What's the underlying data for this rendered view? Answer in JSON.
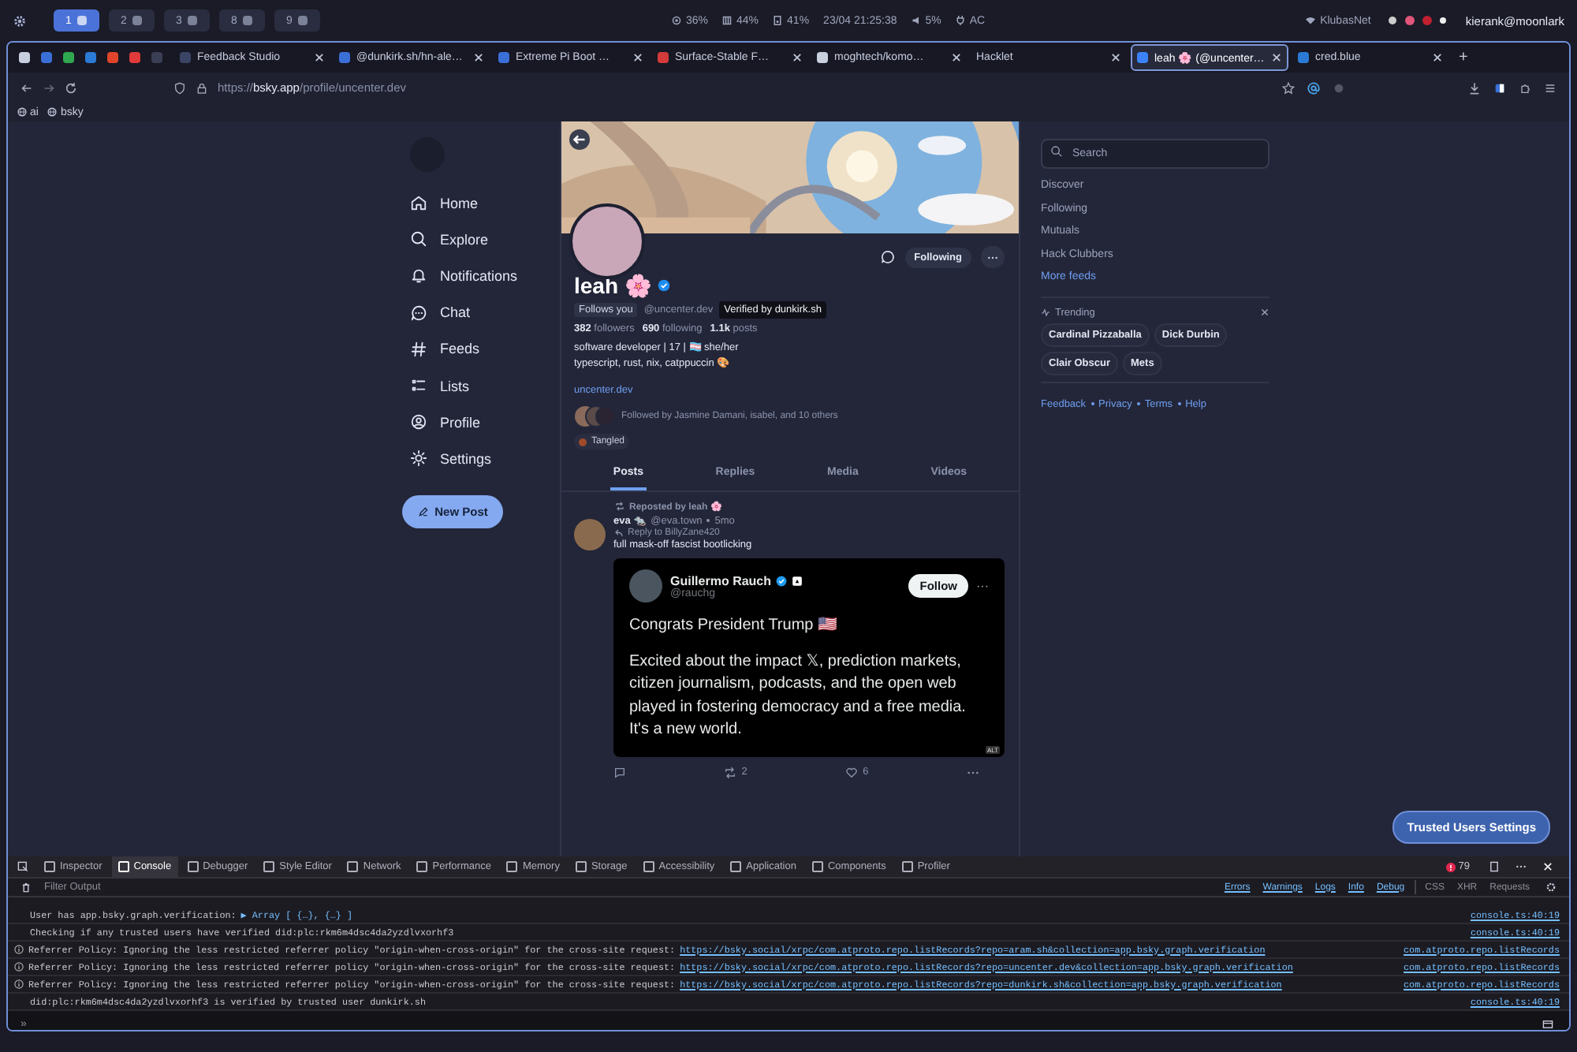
{
  "system_bar": {
    "workspaces": [
      {
        "label": "1",
        "selected": true
      },
      {
        "label": "2",
        "selected": false
      },
      {
        "label": "3",
        "selected": false
      },
      {
        "label": "8",
        "selected": false
      },
      {
        "label": "9",
        "selected": false
      }
    ],
    "cpu": "36%",
    "memory": "44%",
    "disk": "41%",
    "clock": "23/04 21:25:38",
    "volume": "5%",
    "power": "AC",
    "network": "KlubasNet",
    "user": "kierank@moonlark"
  },
  "browser": {
    "tabs": [
      {
        "title": "Feedback Studio",
        "selected": false
      },
      {
        "title": "@dunkirk.sh/hn-ale…",
        "selected": false
      },
      {
        "title": "Extreme Pi Boot …",
        "selected": false
      },
      {
        "title": "Surface-Stable F…",
        "selected": false
      },
      {
        "title": "moghtech/komo…",
        "selected": false
      },
      {
        "title": "Hacklet",
        "selected": false
      },
      {
        "title": "leah 🌸 (@uncenter…",
        "selected": true
      },
      {
        "title": "cred.blue",
        "selected": false
      }
    ],
    "new_tab": "+",
    "url_scheme": "https://",
    "url_host": "bsky.app",
    "url_path": "/profile/uncenter.dev",
    "bookmarks": [
      "ai",
      "bsky"
    ]
  },
  "nav": {
    "items": [
      {
        "label": "Home"
      },
      {
        "label": "Explore"
      },
      {
        "label": "Notifications"
      },
      {
        "label": "Chat"
      },
      {
        "label": "Feeds"
      },
      {
        "label": "Lists"
      },
      {
        "label": "Profile"
      },
      {
        "label": "Settings"
      }
    ],
    "new_post": "New Post"
  },
  "profile": {
    "name": "leah 🌸",
    "verified": true,
    "follow_button": "Following",
    "follows_you": "Follows you",
    "handle": "@uncenter.dev",
    "tooltip": "Verified by dunkirk.sh",
    "stats": [
      {
        "count": "382",
        "label": "followers"
      },
      {
        "count": "690",
        "label": "following"
      },
      {
        "count": "1.1k",
        "label": "posts"
      }
    ],
    "bio": [
      "software developer | 17 | 🏳️‍⚧️ she/her",
      "typescript, rust, nix, catppuccin 🎨"
    ],
    "link": "uncenter.dev",
    "followed_by": "Followed by Jasmine Damani, isabel, and 10 others",
    "badge": "Tangled"
  },
  "profile_tabs": [
    {
      "label": "Posts",
      "selected": true
    },
    {
      "label": "Replies",
      "selected": false
    },
    {
      "label": "Media",
      "selected": false
    },
    {
      "label": "Videos",
      "selected": false
    }
  ],
  "post": {
    "reposted_by": "Reposted by leah 🌸",
    "author": "eva 🐀",
    "handle": "@eva.town",
    "time": "5mo",
    "reply_to": "Reply to BillyZane420",
    "text": "full mask-off fascist bootlicking",
    "embed": {
      "name": "Guillermo Rauch",
      "verified": true,
      "handle": "@rauchg",
      "follow": "Follow",
      "more": "···",
      "line_1": "Congrats President Trump 🇺🇸",
      "line_2": "Excited about the impact 𝕏, prediction markets, citizen journalism, podcasts, and the open web played in fostering democracy and a free media. It's a new world.",
      "alt": "ALT"
    },
    "reposts": "2",
    "likes": "6"
  },
  "sidebar": {
    "search_placeholder": "Search",
    "feeds": [
      "Discover",
      "Following",
      "Mutuals",
      "Hack Clubbers"
    ],
    "more_feeds": "More feeds",
    "trending_title": "Trending",
    "trending": [
      "Cardinal Pizzaballa",
      "Dick Durbin",
      "Clair Obscur",
      "Mets"
    ],
    "footer": [
      "Feedback",
      "Privacy",
      "Terms",
      "Help"
    ]
  },
  "trusted_button": "Trusted Users Settings",
  "devtools": {
    "tabs": [
      {
        "label": "Inspector",
        "selected": false
      },
      {
        "label": "Console",
        "selected": true
      },
      {
        "label": "Debugger",
        "selected": false
      },
      {
        "label": "Style Editor",
        "selected": false
      },
      {
        "label": "Network",
        "selected": false
      },
      {
        "label": "Performance",
        "selected": false
      },
      {
        "label": "Memory",
        "selected": false
      },
      {
        "label": "Storage",
        "selected": false
      },
      {
        "label": "Accessibility",
        "selected": false
      },
      {
        "label": "Application",
        "selected": false
      },
      {
        "label": "Components",
        "selected": false
      },
      {
        "label": "Profiler",
        "selected": false
      }
    ],
    "error_count": "79",
    "filter_placeholder": "Filter Output",
    "levels": [
      {
        "label": "Errors",
        "on": true
      },
      {
        "label": "Warnings",
        "on": true
      },
      {
        "label": "Logs",
        "on": true
      },
      {
        "label": "Info",
        "on": true
      },
      {
        "label": "Debug",
        "on": true
      }
    ],
    "extras": [
      {
        "label": "CSS",
        "on": false
      },
      {
        "label": "XHR",
        "on": false
      },
      {
        "label": "Requests",
        "on": false
      }
    ],
    "logs": [
      {
        "kind": "log",
        "text": "User has app.bsky.graph.verification:",
        "object": "▶ Array [ {…}, {…} ]",
        "source": "console.ts:40:19"
      },
      {
        "kind": "log",
        "text": "Checking if any trusted users have verified did:plc:rkm6m4dsc4da2yzdlvxorhf3",
        "source": "console.ts:40:19"
      },
      {
        "kind": "info",
        "text": "Referrer Policy: Ignoring the less restricted referrer policy \"origin-when-cross-origin\" for the cross-site request:",
        "url": "https://bsky.social/xrpc/com.atproto.repo.listRecords?repo=aram.sh&collection=app.bsky.graph.verification",
        "source": "com.atproto.repo.listRecords"
      },
      {
        "kind": "info",
        "text": "Referrer Policy: Ignoring the less restricted referrer policy \"origin-when-cross-origin\" for the cross-site request:",
        "url": "https://bsky.social/xrpc/com.atproto.repo.listRecords?repo=uncenter.dev&collection=app.bsky.graph.verification",
        "source": "com.atproto.repo.listRecords"
      },
      {
        "kind": "info",
        "text": "Referrer Policy: Ignoring the less restricted referrer policy \"origin-when-cross-origin\" for the cross-site request:",
        "url": "https://bsky.social/xrpc/com.atproto.repo.listRecords?repo=dunkirk.sh&collection=app.bsky.graph.verification",
        "source": "com.atproto.repo.listRecords"
      },
      {
        "kind": "log",
        "text": "did:plc:rkm6m4dsc4da2yzdlvxorhf3 is verified by trusted user dunkirk.sh",
        "source": "console.ts:40:19"
      }
    ],
    "prompt": "»"
  }
}
